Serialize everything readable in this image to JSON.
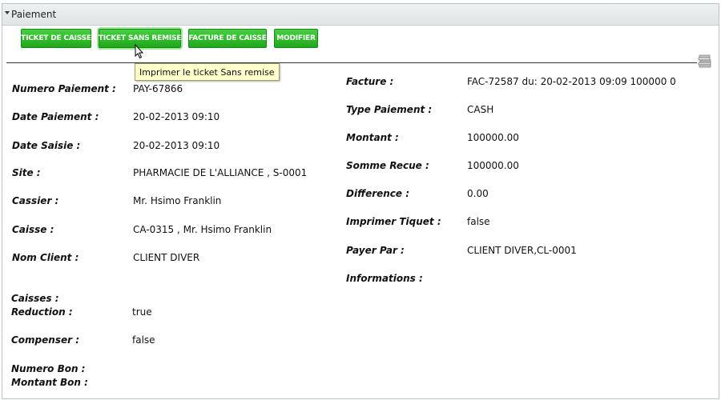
{
  "panel": {
    "title": "Paiement"
  },
  "toolbar": {
    "btn_ticket_caisse": "TICKET DE CAISSE",
    "btn_ticket_sans_remise": "TICKET SANS REMISE",
    "btn_facture_caisse": "FACTURE DE CAISSE",
    "btn_modifier": "MODIFIER",
    "tooltip": "Imprimer le ticket Sans remise"
  },
  "left_fields": [
    {
      "label": "Numero Paiement :",
      "value": "PAY-67866"
    },
    {
      "label": "Date Paiement :",
      "value": "20-02-2013 09:10"
    },
    {
      "label": "Date Saisie :",
      "value": "20-02-2013 09:10"
    },
    {
      "label": "Site :",
      "value": "PHARMACIE DE L'ALLIANCE , S-0001"
    },
    {
      "label": "Cassier :",
      "value": "Mr. Hsimo Franklin"
    },
    {
      "label": "Caisse :",
      "value": "CA-0315 , Mr. Hsimo Franklin"
    },
    {
      "label": "Nom Client :",
      "value": "CLIENT DIVER"
    }
  ],
  "right_fields": [
    {
      "label": "Facture :",
      "value": "FAC-72587 du: 20-02-2013 09:09 100000 0"
    },
    {
      "label": "Type Paiement :",
      "value": "CASH"
    },
    {
      "label": "Montant :",
      "value": "100000.00"
    },
    {
      "label": "Somme Recue :",
      "value": "100000.00"
    },
    {
      "label": "Difference :",
      "value": "0.00"
    },
    {
      "label": "Imprimer Tiquet :",
      "value": "false"
    },
    {
      "label": "Payer Par :",
      "value": "CLIENT DIVER,CL-0001"
    },
    {
      "label": "Informations :",
      "value": ""
    }
  ],
  "bottom_fields": {
    "caisses_label": "Caisses :",
    "reduction_label": "Reduction :",
    "reduction_value": "true",
    "compenser_label": "Compenser :",
    "compenser_value": "false",
    "numero_bon_label": "Numero Bon :",
    "montant_bon_label": "Montant Bon :"
  },
  "colors": {
    "button_green": "#2dbb28",
    "tooltip_bg": "#ffffcc",
    "header_bg": "#e6eaea"
  }
}
